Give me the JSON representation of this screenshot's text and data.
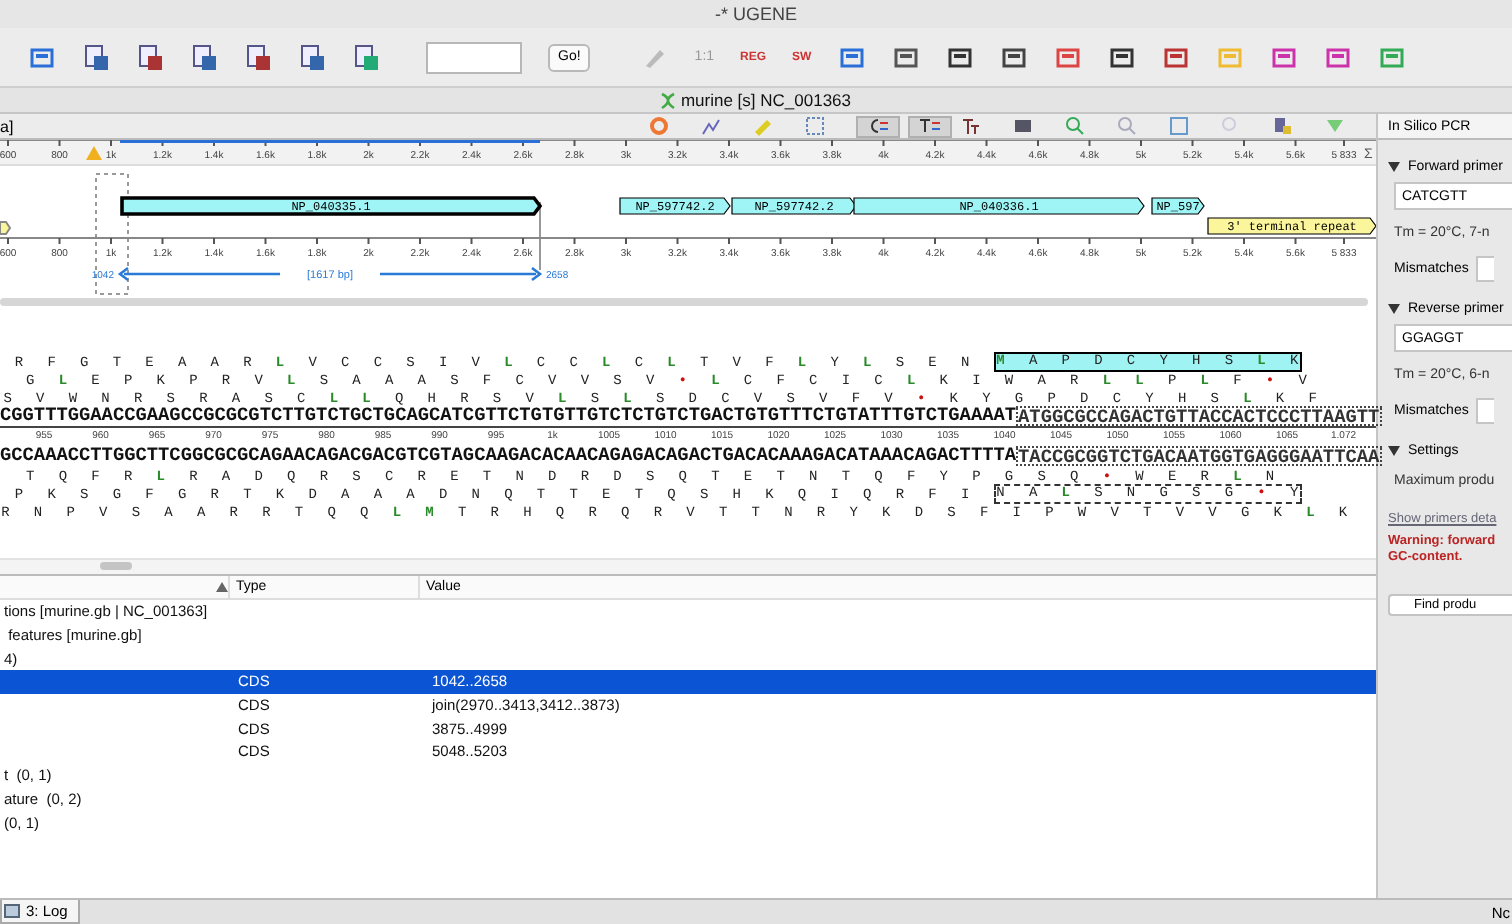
{
  "window": {
    "title": "-* UGENE"
  },
  "toolbar": {
    "go_button": "Go!",
    "zoom_label": "1:1",
    "search_icons": [
      "REG",
      "SW"
    ]
  },
  "document": {
    "title": "murine [s] NC_001363"
  },
  "view_toolbar": {
    "cut_label": "a]",
    "toggles": [
      {
        "kind": "complement",
        "on": true
      },
      {
        "kind": "translation",
        "on": true
      }
    ]
  },
  "overview": {
    "ticks": [
      "600",
      "800",
      "1k",
      "1.2k",
      "1.4k",
      "1.6k",
      "1.8k",
      "2k",
      "2.2k",
      "2.4k",
      "2.6k",
      "2.8k",
      "3k",
      "3.2k",
      "3.4k",
      "3.6k",
      "3.8k",
      "4k",
      "4.2k",
      "4.4k",
      "4.6k",
      "4.8k",
      "5k",
      "5.2k",
      "5.4k",
      "5.6k",
      "5 833"
    ],
    "sum_mark": "Σ"
  },
  "annotation_track": {
    "features": [
      {
        "label": "NP_040335.1",
        "kind": "cds",
        "selected": true
      },
      {
        "label": "NP_597742.2",
        "kind": "cds",
        "selected": false
      },
      {
        "label": "NP_597742.2",
        "kind": "cds",
        "selected": false
      },
      {
        "label": "NP_040336.1",
        "kind": "cds",
        "selected": false
      },
      {
        "label": "NP_597",
        "kind": "cds",
        "selected": false
      },
      {
        "label": "3' terminal repeat",
        "kind": "repeat",
        "selected": false
      }
    ],
    "ticks": [
      "600",
      "800",
      "1k",
      "1.2k",
      "1.4k",
      "1.6k",
      "1.8k",
      "2k",
      "2.2k",
      "2.4k",
      "2.6k",
      "2.8k",
      "3k",
      "3.2k",
      "3.4k",
      "3.6k",
      "3.8k",
      "4k",
      "4.2k",
      "4.4k",
      "4.6k",
      "4.8k",
      "5k",
      "5.2k",
      "5.4k",
      "5.6k",
      "5 833"
    ],
    "selection": {
      "start": "1042",
      "length": "[1617 bp]",
      "end": "2658"
    }
  },
  "sequence": {
    "forward_frames": [
      {
        "plain": "R  F  G  T  E  A  A  R  L  V  C  C  S  I  V  L  C  C  L  C  L  T  V  F  L  Y  L  S  E  N",
        "selected": "M  A  P  D  C  Y  H  S  L  K"
      },
      {
        "plain": "G  L  E  P  K  P  R  V  L  S  A  A  A  S  F  C  V  V  S  V  •  L  C  F  C  I  C  L  K  I  W  A  R  L  L  P  L  F  •  V"
      },
      {
        "plain": "S  V  W  N  R  S  R  A  S  C  L  L  Q  H  R  S  V  L  S  L  S  D  C  V  S  V  F  V  •  K  Y  G  P  D  C  Y  H  S  L  K  F"
      }
    ],
    "top_strand": {
      "plain": "CGGTTTGGAACCGAAGCCGCGCGTCTTGTCTGCTGCAGCATCGTTCTGTGTTGTCTCTGTCTGACTGTGTTTCTGTATTTGTCTGAAAAT",
      "selected": "ATGGCGCCAGACTGTTACCACTCCCTTAAGTT"
    },
    "ruler": [
      "955",
      "960",
      "965",
      "970",
      "975",
      "980",
      "985",
      "990",
      "995",
      "1k",
      "1005",
      "1010",
      "1015",
      "1020",
      "1025",
      "1030",
      "1035",
      "1040",
      "1045",
      "1050",
      "1055",
      "1060",
      "1065",
      "1.072"
    ],
    "bottom_strand": {
      "plain": "GCCAAACCTTGGCTTCGGCGCGCAGAACAGACGACGTCGTAGCAAGACACAACAGAGACAGACTGACACAAAGACATAAACAGACTTTTA",
      "selected": "TACCGCGGTCTGACAATGGTGAGGGAATTCAA"
    },
    "reverse_frames": [
      {
        "plain": "T  Q  F  R  L  R  A  D  Q  R  S  C  R  E  T  N  D  R  D  S  Q  T  E  T  N  T  Q  F  Y  P  G  S  Q  •  W  E  R  L  N"
      },
      {
        "plain": "P  K  S  G  F  G  R  T  K  D  A  A  A  D  N  Q  T  T  E  T  Q  S  H  K  Q  I  Q  R  F  I",
        "selected": "N  A  L  S  N  G  S  G  •  Y"
      },
      {
        "plain": "R  N  P  V  S  A  A  R  R  T  Q  Q  L  M  T  R  H  Q  R  Q  R  V  T  T  N  R  Y  K  D  S  F  I  P  W  V  T  V  V  G  K  L  K"
      }
    ]
  },
  "annotations": {
    "columns": [
      "Type",
      "Value"
    ],
    "rows": [
      {
        "name": "tions [murine.gb | NC_001363]",
        "selected": false
      },
      {
        "name": " features [murine.gb]",
        "selected": false
      },
      {
        "name": "4)",
        "selected": false
      },
      {
        "type": "CDS",
        "value": "1042..2658",
        "selected": true
      },
      {
        "type": "CDS",
        "value": "join(2970..3413,3412..3873)",
        "selected": false
      },
      {
        "type": "CDS",
        "value": "3875..4999",
        "selected": false
      },
      {
        "type": "CDS",
        "value": "5048..5203",
        "selected": false
      },
      {
        "name": "t  (0, 1)",
        "selected": false
      },
      {
        "name": "ature  (0, 2)",
        "selected": false
      },
      {
        "name": "(0, 1)",
        "selected": false
      }
    ]
  },
  "pcr_panel": {
    "title": "In Silico PCR",
    "sections": [
      {
        "kind": "primer",
        "header": "Forward primer",
        "expanded": true,
        "value": "CATCGTT",
        "tm": "Tm = 20°C, 7-n",
        "mismatches": "Mismatches"
      },
      {
        "kind": "primer",
        "header": "Reverse primer",
        "expanded": true,
        "value": "GGAGGT",
        "tm": "Tm = 20°C, 6-n",
        "mismatches": "Mismatches"
      },
      {
        "kind": "settings",
        "header": "Settings",
        "expanded": true,
        "label": "Maximum produ"
      }
    ],
    "details_link": "Show primers deta",
    "warning": "Warning: forward GC-content.",
    "find_button": "Find produ"
  },
  "status_bar": {
    "log_tab": "3: Log",
    "right_text": "Nc"
  }
}
